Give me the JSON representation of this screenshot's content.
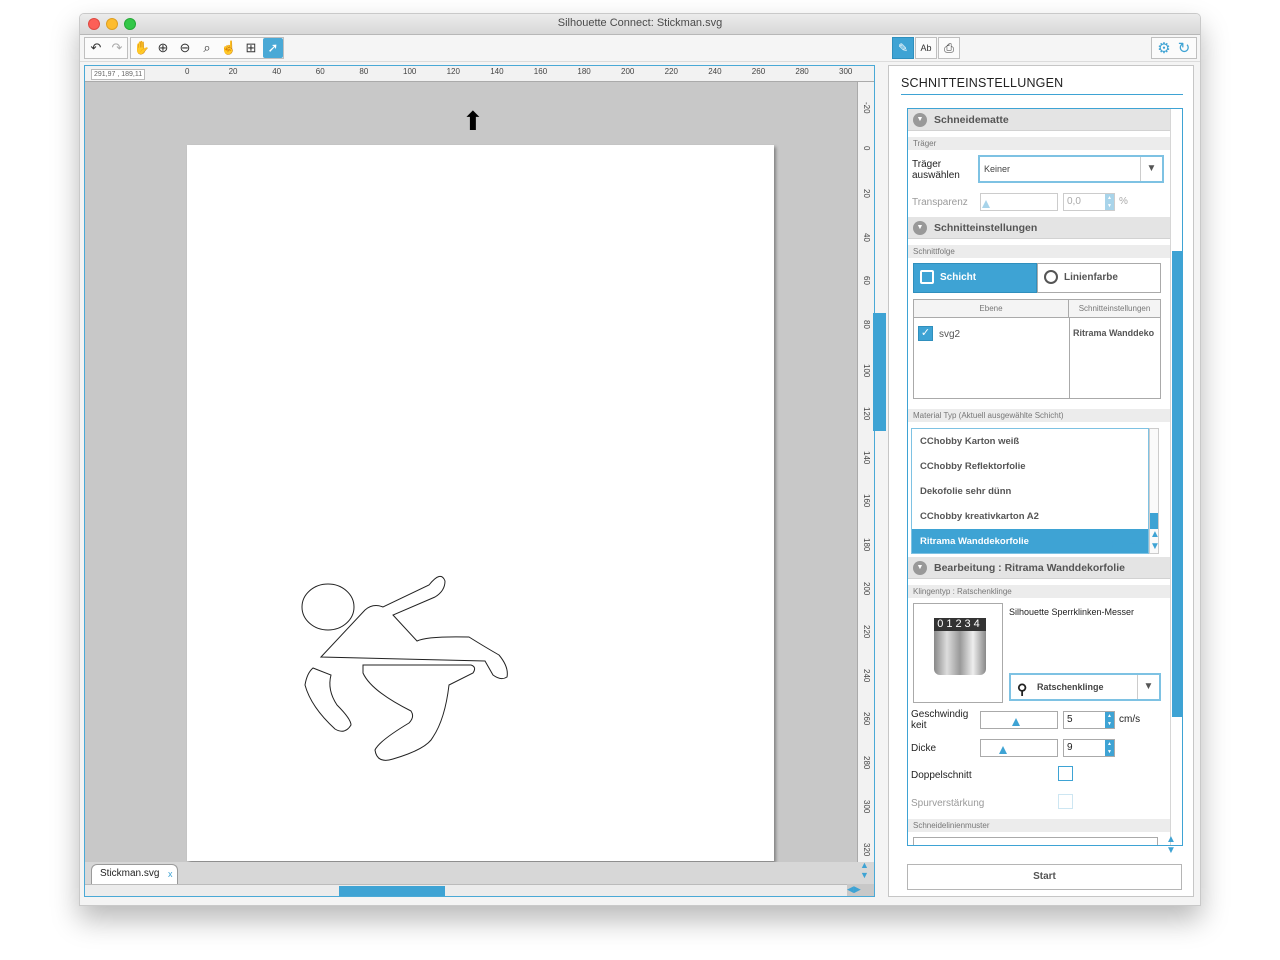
{
  "window": {
    "title": "Silhouette Connect: Stickman.svg"
  },
  "toolbar": {
    "icons": [
      "undo-icon",
      "redo-icon",
      "pan-icon",
      "zoom-in-icon",
      "zoom-out-icon",
      "zoom-select-icon",
      "zoom-drag-icon",
      "fit-page-icon",
      "select-icon"
    ]
  },
  "ruler": {
    "coords": "291,97 , 189,11",
    "h_labels": [
      "0",
      "20",
      "40",
      "60",
      "80",
      "100",
      "120",
      "140",
      "160",
      "180",
      "200",
      "220",
      "240",
      "260",
      "280",
      "300"
    ],
    "v_labels": [
      "-20",
      "0",
      "20",
      "40",
      "60",
      "80",
      "100",
      "120",
      "140",
      "160",
      "180",
      "200",
      "220",
      "240",
      "260",
      "280",
      "300",
      "320"
    ]
  },
  "document": {
    "tab_label": "Stickman.svg",
    "tab_close": "x"
  },
  "panel": {
    "title": "SCHNITTEINSTELLUNGEN",
    "start_label": "Start",
    "mat": {
      "header": "Schneidematte",
      "sub": "Träger",
      "carrier_label": "Träger auswählen",
      "carrier_value": "Keiner",
      "transparency_label": "Transparenz",
      "transparency_value": "0,0",
      "transparency_unit": "%"
    },
    "cut": {
      "header": "Schnitteinstellungen",
      "sub": "Schnittfolge",
      "seg_layer": "Schicht",
      "seg_linecolor": "Linienfarbe",
      "col_layer": "Ebene",
      "col_settings": "Schnitteinstellungen",
      "row_layer": "svg2",
      "row_settings": "Ritrama Wanddeko"
    },
    "material": {
      "sub": "Material Typ (Aktuell ausgewählte Schicht)",
      "items": [
        "CChobby Karton weiß",
        "CChobby Reflektorfolie",
        "Dekofolie sehr dünn",
        "CChobby kreativkarton A2",
        "Ritrama Wanddekorfolie"
      ],
      "selected": 4,
      "add": "+",
      "remove": "−"
    },
    "edit": {
      "header": "Bearbeitung : Ritrama Wanddekorfolie",
      "sub": "Klingentyp : Ratschenklinge",
      "blade_name": "Silhouette Sperrklinken-Messer",
      "blade_digits": "01234",
      "blade_select": "Ratschenklinge",
      "speed_label": "Geschwindig keit",
      "speed_value": "5",
      "speed_unit": "cm/s",
      "speed_level": 0.45,
      "thickness_label": "Dicke",
      "thickness_value": "9",
      "thickness_level": 0.27,
      "double_cut_label": "Doppelschnitt",
      "track_label": "Spurverstärkung",
      "pattern_sub": "Schneidelinienmuster"
    }
  }
}
